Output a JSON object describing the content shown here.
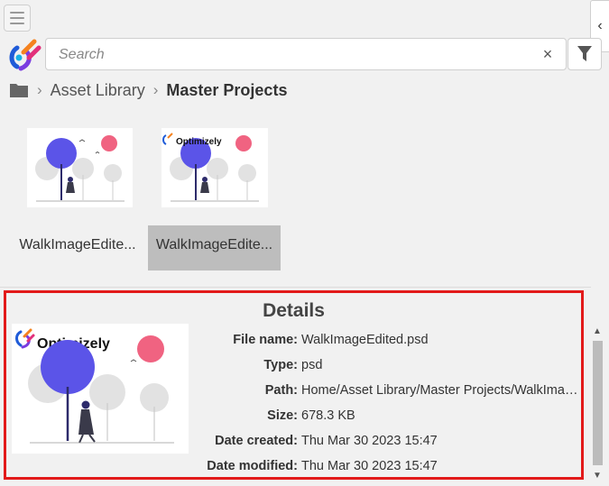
{
  "header": {
    "search": {
      "placeholder": "Search",
      "value": ""
    },
    "clear_glyph": "×",
    "collapse_glyph": "‹"
  },
  "breadcrumb": {
    "items": [
      "Asset Library",
      "Master Projects"
    ]
  },
  "assets": [
    {
      "name": "WalkImageEdite...",
      "has_logo": false,
      "selected": false
    },
    {
      "name": "WalkImageEdite...",
      "has_logo": true,
      "selected": true
    }
  ],
  "details": {
    "title": "Details",
    "logo_text": "Optimizely",
    "properties": [
      {
        "label": "File name:",
        "value": "WalkImageEdited.psd"
      },
      {
        "label": "Type:",
        "value": "psd"
      },
      {
        "label": "Path:",
        "value": "Home/Asset Library/Master Projects/WalkImage..."
      },
      {
        "label": "Size:",
        "value": "678.3 KB"
      },
      {
        "label": "Date created:",
        "value": "Thu Mar 30 2023 15:47"
      },
      {
        "label": "Date modified:",
        "value": "Thu Mar 30 2023 15:47"
      }
    ]
  },
  "colors": {
    "highlight_border": "#e21a1a",
    "illustration_purple": "#5b54e8",
    "illustration_pink": "#f06381",
    "selected_tile": "#bdbdbd"
  }
}
